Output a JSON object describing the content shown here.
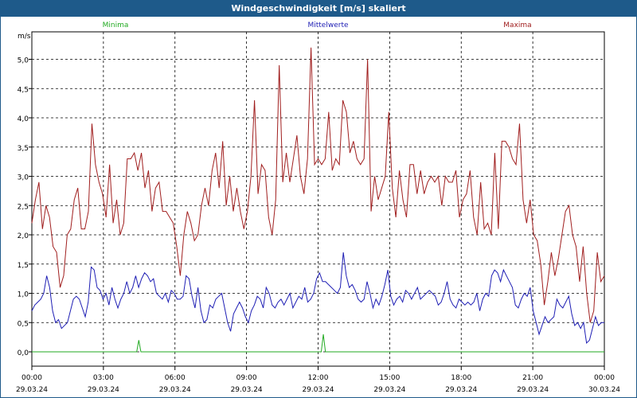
{
  "title": "Windgeschwindigkeit [m/s] skaliert",
  "chart_data": {
    "type": "line",
    "unit": "m/s",
    "ylim": [
      0,
      5.5
    ],
    "xlim": [
      0,
      24
    ],
    "y_ticks": [
      "0,0",
      "0,5",
      "1,0",
      "1,5",
      "2,0",
      "2,5",
      "3,0",
      "3,5",
      "4,0",
      "4,5",
      "5,0"
    ],
    "x_ticks": [
      {
        "time": "00:00",
        "date": "29.03.24"
      },
      {
        "time": "03:00",
        "date": "29.03.24"
      },
      {
        "time": "06:00",
        "date": "29.03.24"
      },
      {
        "time": "09:00",
        "date": "29.03.24"
      },
      {
        "time": "12:00",
        "date": "29.03.24"
      },
      {
        "time": "15:00",
        "date": "29.03.24"
      },
      {
        "time": "18:00",
        "date": "29.03.24"
      },
      {
        "time": "21:00",
        "date": "29.03.24"
      },
      {
        "time": "00:00",
        "date": "30.03.24"
      }
    ],
    "grid": true,
    "legend_position": "top",
    "series": [
      {
        "name": "Minima",
        "color": "#22aa22",
        "values": [
          0,
          0,
          0,
          0,
          0,
          0,
          0,
          0,
          0,
          0,
          0,
          0,
          0,
          0,
          0,
          0,
          0,
          0,
          0,
          0,
          0,
          0,
          0,
          0,
          0,
          0,
          0,
          0,
          0,
          0,
          0,
          0,
          0,
          0,
          0,
          0,
          0,
          0,
          0,
          0,
          0,
          0,
          0,
          0,
          0,
          0,
          0,
          0,
          0,
          0,
          0,
          0.2,
          0,
          0,
          0,
          0,
          0,
          0,
          0,
          0,
          0,
          0,
          0,
          0,
          0,
          0,
          0,
          0,
          0,
          0,
          0,
          0,
          0,
          0,
          0,
          0,
          0,
          0,
          0,
          0,
          0,
          0,
          0,
          0,
          0,
          0,
          0,
          0,
          0,
          0,
          0,
          0,
          0,
          0,
          0,
          0,
          0,
          0,
          0,
          0,
          0,
          0,
          0,
          0,
          0,
          0,
          0,
          0,
          0,
          0,
          0,
          0,
          0,
          0,
          0,
          0,
          0,
          0,
          0,
          0,
          0,
          0,
          0,
          0,
          0,
          0,
          0,
          0,
          0,
          0,
          0,
          0,
          0,
          0,
          0,
          0,
          0,
          0,
          0,
          0.3,
          0,
          0,
          0,
          0,
          0,
          0,
          0,
          0,
          0,
          0,
          0,
          0,
          0,
          0,
          0,
          0,
          0,
          0,
          0,
          0,
          0,
          0,
          0,
          0,
          0,
          0,
          0,
          0,
          0,
          0,
          0,
          0,
          0,
          0,
          0,
          0,
          0,
          0,
          0,
          0,
          0,
          0,
          0,
          0,
          0,
          0,
          0,
          0,
          0,
          0,
          0,
          0,
          0,
          0,
          0,
          0,
          0,
          0,
          0,
          0,
          0,
          0,
          0,
          0,
          0,
          0,
          0,
          0,
          0,
          0,
          0,
          0,
          0,
          0,
          0,
          0,
          0,
          0,
          0,
          0,
          0,
          0,
          0,
          0,
          0,
          0,
          0,
          0,
          0,
          0,
          0,
          0,
          0,
          0,
          0,
          0,
          0,
          0,
          0,
          0,
          0,
          0,
          0,
          0,
          0,
          0,
          0,
          0,
          0,
          0,
          0,
          0,
          0,
          0,
          0,
          0,
          0,
          0,
          0,
          0,
          0,
          0,
          0,
          0,
          0,
          0,
          0,
          0,
          0,
          0,
          0,
          0,
          0,
          0
        ]
      },
      {
        "name": "Mittelwerte",
        "color": "#1e1eb4",
        "values": [
          0.7,
          0.8,
          0.85,
          0.9,
          1.0,
          1.3,
          1.1,
          0.7,
          0.5,
          0.55,
          0.4,
          0.45,
          0.5,
          0.7,
          0.9,
          0.95,
          0.9,
          0.75,
          0.6,
          0.85,
          1.45,
          1.4,
          1.1,
          1.05,
          0.9,
          1.0,
          0.8,
          1.1,
          0.9,
          0.75,
          0.9,
          1.0,
          1.2,
          1.0,
          1.1,
          1.3,
          1.1,
          1.25,
          1.35,
          1.3,
          1.2,
          1.25,
          1.0,
          0.95,
          0.9,
          1.0,
          0.85,
          1.05,
          1.0,
          0.9,
          0.9,
          0.95,
          1.3,
          1.25,
          0.95,
          0.75,
          1.1,
          0.7,
          0.5,
          0.55,
          0.8,
          0.75,
          0.9,
          0.95,
          1.0,
          0.75,
          0.5,
          0.35,
          0.65,
          0.75,
          0.85,
          0.75,
          0.6,
          0.5,
          0.7,
          0.8,
          0.95,
          0.9,
          0.75,
          1.1,
          1.0,
          0.8,
          0.75,
          0.85,
          0.9,
          0.8,
          0.9,
          1.0,
          0.75,
          0.85,
          0.95,
          0.9,
          1.1,
          0.85,
          0.9,
          1.0,
          1.25,
          1.35,
          1.2,
          1.2,
          1.15,
          1.1,
          1.05,
          1.0,
          1.1,
          1.7,
          1.3,
          1.1,
          1.15,
          1.05,
          0.9,
          0.85,
          0.9,
          1.2,
          1.0,
          0.75,
          0.9,
          0.8,
          0.95,
          1.15,
          1.4,
          0.95,
          0.8,
          0.9,
          0.95,
          0.85,
          1.05,
          1.0,
          0.9,
          1.0,
          1.1,
          0.9,
          0.95,
          1.0,
          1.05,
          1.0,
          0.95,
          0.8,
          0.85,
          1.0,
          1.2,
          0.9,
          0.8,
          0.75,
          0.9,
          0.85,
          0.8,
          0.85,
          0.8,
          0.85,
          1.0,
          0.7,
          0.9,
          1.0,
          0.95,
          1.3,
          1.4,
          1.35,
          1.2,
          1.4,
          1.3,
          1.2,
          1.1,
          0.8,
          0.75,
          0.9,
          1.0,
          0.95,
          1.1,
          0.7,
          0.5,
          0.3,
          0.45,
          0.6,
          0.5,
          0.55,
          0.6,
          0.9,
          0.8,
          0.75,
          0.85,
          0.95,
          0.65,
          0.45,
          0.5,
          0.4,
          0.5,
          0.15,
          0.2,
          0.4,
          0.6,
          0.45,
          0.5,
          0.5
        ]
      },
      {
        "name": "Maxima",
        "color": "#a01e1e",
        "values": [
          2.2,
          2.6,
          2.9,
          2.1,
          2.5,
          2.3,
          1.8,
          1.7,
          1.1,
          1.3,
          2.0,
          2.1,
          2.6,
          2.8,
          2.1,
          2.1,
          2.4,
          3.9,
          3.2,
          2.9,
          2.7,
          2.3,
          3.2,
          2.2,
          2.6,
          2.0,
          2.2,
          3.3,
          3.3,
          3.4,
          3.1,
          3.4,
          2.8,
          3.1,
          2.4,
          2.8,
          2.9,
          2.4,
          2.4,
          2.3,
          2.2,
          1.8,
          1.3,
          2.0,
          2.4,
          2.2,
          1.9,
          2.0,
          2.5,
          2.8,
          2.5,
          3.1,
          3.4,
          2.8,
          3.6,
          2.5,
          3.0,
          2.4,
          2.8,
          2.4,
          2.1,
          2.4,
          3.0,
          4.3,
          2.7,
          3.2,
          3.1,
          2.3,
          2.0,
          2.6,
          4.9,
          2.9,
          3.4,
          2.9,
          3.3,
          3.7,
          3.0,
          2.7,
          3.3,
          5.2,
          3.2,
          3.3,
          3.2,
          3.3,
          4.1,
          3.1,
          3.3,
          3.2,
          4.3,
          4.1,
          3.4,
          3.6,
          3.3,
          3.2,
          3.3,
          5.0,
          2.4,
          3.0,
          2.6,
          2.8,
          3.0,
          4.1,
          2.8,
          2.3,
          3.1,
          2.6,
          2.3,
          3.2,
          3.2,
          2.7,
          3.1,
          2.7,
          2.9,
          3.0,
          2.9,
          3.0,
          2.5,
          3.0,
          2.9,
          2.9,
          3.1,
          2.3,
          2.6,
          2.7,
          3.1,
          2.3,
          2.0,
          2.9,
          2.1,
          2.2,
          2.0,
          3.4,
          2.1,
          3.6,
          3.6,
          3.5,
          3.3,
          3.2,
          3.9,
          2.6,
          2.2,
          2.6,
          2.0,
          1.9,
          1.5,
          0.8,
          1.2,
          1.7,
          1.3,
          1.6,
          2.0,
          2.4,
          2.5,
          2.0,
          1.8,
          1.2,
          1.8,
          1.0,
          0.5,
          0.7,
          1.7,
          1.2,
          1.3
        ]
      }
    ]
  }
}
